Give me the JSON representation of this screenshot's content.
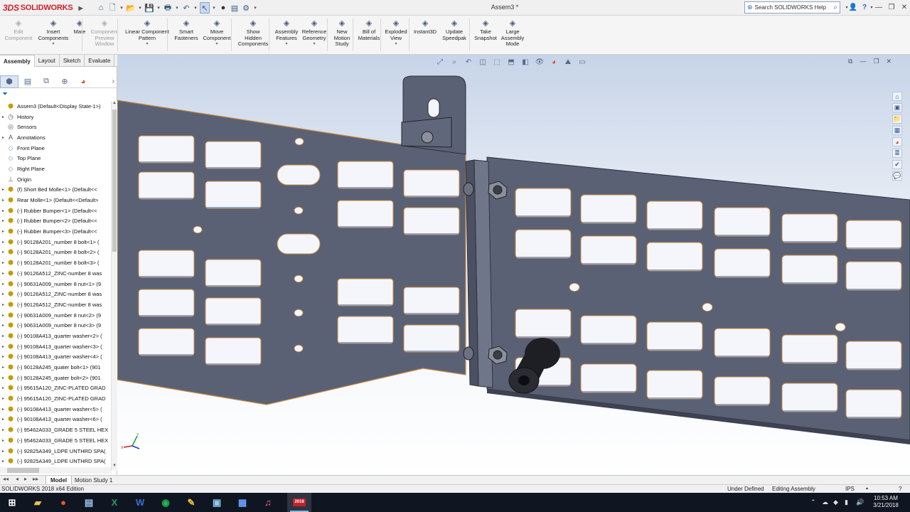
{
  "app": {
    "brand": "SOLIDWORKS",
    "brand_mark": "3DS",
    "document_title": "Assem3 *"
  },
  "titlebar": {
    "search_placeholder": "Search SOLIDWORKS Help",
    "controls": [
      "person-icon",
      "help-icon",
      "minimize-icon",
      "restore-icon",
      "close-icon"
    ]
  },
  "toolbar": [
    {
      "label": "Edit\nComponent",
      "icon": "edit-component-icon",
      "disabled": true
    },
    {
      "label": "Insert\nComponents",
      "icon": "insert-components-icon",
      "disabled": false,
      "dropdown": true
    },
    {
      "label": "Mate",
      "icon": "mate-icon",
      "disabled": false
    },
    {
      "label": "Component\nPreview\nWindow",
      "icon": "preview-window-icon",
      "disabled": true
    },
    {
      "label": "Linear Component\nPattern",
      "icon": "linear-pattern-icon",
      "disabled": false,
      "dropdown": true
    },
    {
      "label": "Smart\nFasteners",
      "icon": "smart-fasteners-icon",
      "disabled": false
    },
    {
      "label": "Move\nComponent",
      "icon": "move-component-icon",
      "disabled": false,
      "dropdown": true
    },
    {
      "label": "Show\nHidden\nComponents",
      "icon": "show-hidden-icon",
      "disabled": false
    },
    {
      "label": "Assembly\nFeatures",
      "icon": "assembly-features-icon",
      "disabled": false,
      "dropdown": true
    },
    {
      "label": "Reference\nGeometry",
      "icon": "reference-geometry-icon",
      "disabled": false,
      "dropdown": true
    },
    {
      "label": "New\nMotion\nStudy",
      "icon": "motion-study-icon",
      "disabled": false
    },
    {
      "label": "Bill of\nMaterials",
      "icon": "bom-icon",
      "disabled": false
    },
    {
      "label": "Exploded\nView",
      "icon": "exploded-view-icon",
      "disabled": false,
      "dropdown": true
    },
    {
      "label": "Instant3D",
      "icon": "instant3d-icon",
      "disabled": false
    },
    {
      "label": "Update\nSpeedpak",
      "icon": "speedpak-icon",
      "disabled": false
    },
    {
      "label": "Take\nSnapshot",
      "icon": "snapshot-icon",
      "disabled": false
    },
    {
      "label": "Large\nAssembly\nMode",
      "icon": "large-assembly-icon",
      "disabled": false
    }
  ],
  "command_tabs": [
    "Assembly",
    "Layout",
    "Sketch",
    "Evaluate"
  ],
  "active_command_tab": "Assembly",
  "tree": [
    {
      "label": "Assem3  (Default<Display State-1>)",
      "icon": "assembly-icon",
      "expander": false
    },
    {
      "label": "History",
      "icon": "history-icon",
      "expander": true
    },
    {
      "label": "Sensors",
      "icon": "sensors-icon",
      "expander": false
    },
    {
      "label": "Annotations",
      "icon": "annotations-icon",
      "expander": true
    },
    {
      "label": "Front Plane",
      "icon": "plane-icon",
      "expander": false
    },
    {
      "label": "Top Plane",
      "icon": "plane-icon",
      "expander": false
    },
    {
      "label": "Right Plane",
      "icon": "plane-icon",
      "expander": false
    },
    {
      "label": "Origin",
      "icon": "origin-icon",
      "expander": false
    },
    {
      "label": "(f) Short Bed Molle<1> (Default<<",
      "icon": "part-icon",
      "expander": true
    },
    {
      "label": "Rear Molle<1> (Default<<Default>",
      "icon": "part-icon",
      "expander": true
    },
    {
      "label": "(-) Rubber Bumper<1> (Default<<",
      "icon": "part-icon",
      "expander": true
    },
    {
      "label": "(-) Rubber Bumper<2> (Default<<",
      "icon": "part-icon",
      "expander": true
    },
    {
      "label": "(-) Rubber Bumper<3> (Default<<",
      "icon": "part-icon",
      "expander": true
    },
    {
      "label": "(-) 90128A201_number 8 bolt<1> (",
      "icon": "part-icon",
      "expander": true
    },
    {
      "label": "(-) 90128A201_number 8 bolt<2> (",
      "icon": "part-icon",
      "expander": true
    },
    {
      "label": "(-) 90128A201_number 8 bolt<3> (",
      "icon": "part-icon",
      "expander": true
    },
    {
      "label": "(-) 90126A512_ZINC-number 8 was",
      "icon": "part-icon",
      "expander": true
    },
    {
      "label": "(-) 90631A009_number 8 nut<1> (9",
      "icon": "part-icon",
      "expander": true
    },
    {
      "label": "(-) 90126A512_ZINC-number 8 was",
      "icon": "part-icon",
      "expander": true
    },
    {
      "label": "(-) 90126A512_ZINC-number 8 was",
      "icon": "part-icon",
      "expander": true
    },
    {
      "label": "(-) 90631A009_number 8 nut<2> (9",
      "icon": "part-icon",
      "expander": true
    },
    {
      "label": "(-) 90631A009_number 8 nut<3> (9",
      "icon": "part-icon",
      "expander": true
    },
    {
      "label": "(-) 90108A413_quarter washer<2> (",
      "icon": "part-icon",
      "expander": true
    },
    {
      "label": "(-) 90108A413_quarter washer<3> (",
      "icon": "part-icon",
      "expander": true
    },
    {
      "label": "(-) 90108A413_quarter washer<4> (",
      "icon": "part-icon",
      "expander": true
    },
    {
      "label": "(-) 90128A245_quater bolt<1> (901",
      "icon": "part-icon",
      "expander": true
    },
    {
      "label": "(-) 90128A245_quater bolt<2> (901",
      "icon": "part-icon",
      "expander": true
    },
    {
      "label": "(-) 95615A120_ZINC-PLATED GRAD",
      "icon": "part-icon",
      "expander": true
    },
    {
      "label": "(-) 95615A120_ZINC-PLATED GRAD",
      "icon": "part-icon",
      "expander": true
    },
    {
      "label": "(-) 90108A413_quarter washer<5> (",
      "icon": "part-icon",
      "expander": true
    },
    {
      "label": "(-) 90108A413_quarter washer<6> (",
      "icon": "part-icon",
      "expander": true
    },
    {
      "label": "(-) 95462A033_GRADE 5 STEEL HEX",
      "icon": "part-icon",
      "expander": true
    },
    {
      "label": "(-) 95462A033_GRADE 5 STEEL HEX",
      "icon": "part-icon",
      "expander": true
    },
    {
      "label": "(-) 92825A349_LDPE UNTHRD SPA(",
      "icon": "part-icon",
      "expander": true
    },
    {
      "label": "(-) 92825A349_LDPE UNTHRD SPA(",
      "icon": "part-icon",
      "expander": true
    }
  ],
  "bottom_tabs": [
    "Model",
    "Motion Study 1"
  ],
  "active_bottom_tab": "Model",
  "status": {
    "left": "SOLIDWORKS 2018 x64 Edition",
    "defined": "Under Defined",
    "mode": "Editing Assembly",
    "units": "IPS"
  },
  "taskbar": {
    "time": "10:53 AM",
    "date": "3/21/2018",
    "solidworks_badge": "2018"
  },
  "colors": {
    "sheet_metal": "#5b6175",
    "sheet_edge": "#c98a3e",
    "brand_red": "#d31f26",
    "taskbar": "#101621"
  }
}
